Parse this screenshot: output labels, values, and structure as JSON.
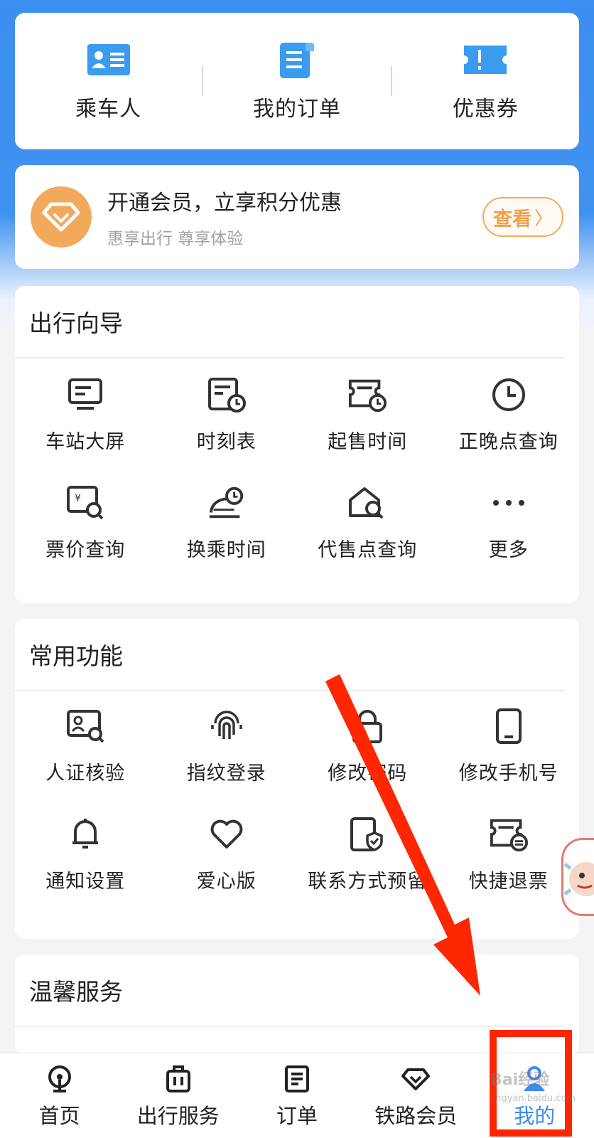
{
  "quick": {
    "items": [
      {
        "label": "乘车人",
        "icon": "passenger-card-icon"
      },
      {
        "label": "我的订单",
        "icon": "order-list-icon"
      },
      {
        "label": "优惠券",
        "icon": "coupon-icon"
      }
    ]
  },
  "member": {
    "title": "开通会员，立享积分优惠",
    "subtitle": "惠享出行 尊享体验",
    "button_label": "查看",
    "button_chevron": "〉",
    "accent": "#f3a95b"
  },
  "guide": {
    "title": "出行向导",
    "items": [
      {
        "label": "车站大屏",
        "icon": "station-screen-icon"
      },
      {
        "label": "时刻表",
        "icon": "timetable-icon"
      },
      {
        "label": "起售时间",
        "icon": "sale-time-icon"
      },
      {
        "label": "正晚点查询",
        "icon": "clock-icon"
      },
      {
        "label": "票价查询",
        "icon": "fare-search-icon"
      },
      {
        "label": "换乘时间",
        "icon": "transfer-time-icon"
      },
      {
        "label": "代售点查询",
        "icon": "agency-search-icon"
      },
      {
        "label": "更多",
        "icon": "more-icon"
      }
    ]
  },
  "common": {
    "title": "常用功能",
    "items": [
      {
        "label": "人证核验",
        "icon": "id-verify-icon"
      },
      {
        "label": "指纹登录",
        "icon": "fingerprint-icon"
      },
      {
        "label": "修改密码",
        "icon": "lock-icon"
      },
      {
        "label": "修改手机号",
        "icon": "phone-icon"
      },
      {
        "label": "通知设置",
        "icon": "bell-icon"
      },
      {
        "label": "爱心版",
        "icon": "heart-icon"
      },
      {
        "label": "联系方式预留",
        "icon": "contact-shield-icon"
      },
      {
        "label": "快捷退票",
        "icon": "quick-refund-icon"
      }
    ]
  },
  "warm": {
    "title": "温馨服务"
  },
  "nav": {
    "items": [
      {
        "label": "首页",
        "icon": "home-icon"
      },
      {
        "label": "出行服务",
        "icon": "luggage-icon"
      },
      {
        "label": "订单",
        "icon": "order-icon"
      },
      {
        "label": "铁路会员",
        "icon": "member-diamond-icon"
      },
      {
        "label": "我的",
        "icon": "user-icon",
        "active": true
      }
    ],
    "active_color": "#3d8bef"
  },
  "watermark": {
    "text": "Bai经验",
    "sub": "jingyan.baidu.com"
  },
  "colors": {
    "primary_blue": "#3b8ff0",
    "annotation_red": "#ff2600",
    "member_orange": "#f3a95b"
  }
}
